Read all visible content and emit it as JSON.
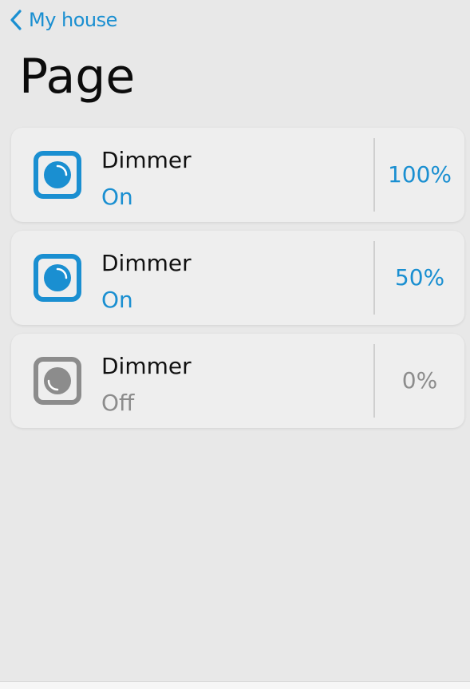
{
  "colors": {
    "accent": "#1a8fd1",
    "off": "#8c8c8c",
    "background": "#e8e8e8",
    "card": "#eeeeee"
  },
  "header": {
    "back_label": "My house",
    "back_icon": "chevron-left-icon",
    "title": "Page"
  },
  "devices": [
    {
      "name": "Dimmer",
      "state": "On",
      "value": "100%",
      "level": 1.0,
      "on": true,
      "icon": "dimmer-icon"
    },
    {
      "name": "Dimmer",
      "state": "On",
      "value": "50%",
      "level": 0.5,
      "on": true,
      "icon": "dimmer-icon"
    },
    {
      "name": "Dimmer",
      "state": "Off",
      "value": "0%",
      "level": 0.0,
      "on": false,
      "icon": "dimmer-icon"
    }
  ]
}
